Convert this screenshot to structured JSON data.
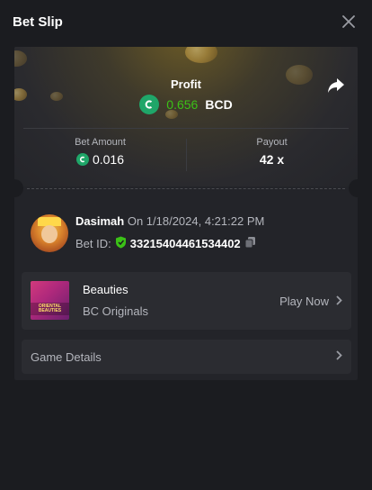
{
  "header": {
    "title": "Bet Slip"
  },
  "profit": {
    "label": "Profit",
    "value": "0.656",
    "currency": "BCD"
  },
  "stats": {
    "bet_amount_label": "Bet Amount",
    "bet_amount_value": "0.016",
    "payout_label": "Payout",
    "payout_value": "42 x"
  },
  "user": {
    "name": "Dasimah",
    "date": "On 1/18/2024, 4:21:22 PM",
    "bet_id_label": "Bet ID:",
    "bet_id_value": "33215404461534402"
  },
  "game": {
    "name": "Beauties",
    "provider": "BC Originals",
    "play_label": "Play Now",
    "thumb_text": "ORIENTAL BEAUTIES"
  },
  "details": {
    "label": "Game Details"
  },
  "colors": {
    "profit_green": "#3bc117",
    "bc_green": "#1fa669",
    "background": "#1b1c20",
    "card": "#232429"
  },
  "icons": [
    "bc-coin-icon",
    "share-icon",
    "close-icon",
    "verified-shield-icon",
    "copy-icon",
    "chevron-right-icon"
  ]
}
